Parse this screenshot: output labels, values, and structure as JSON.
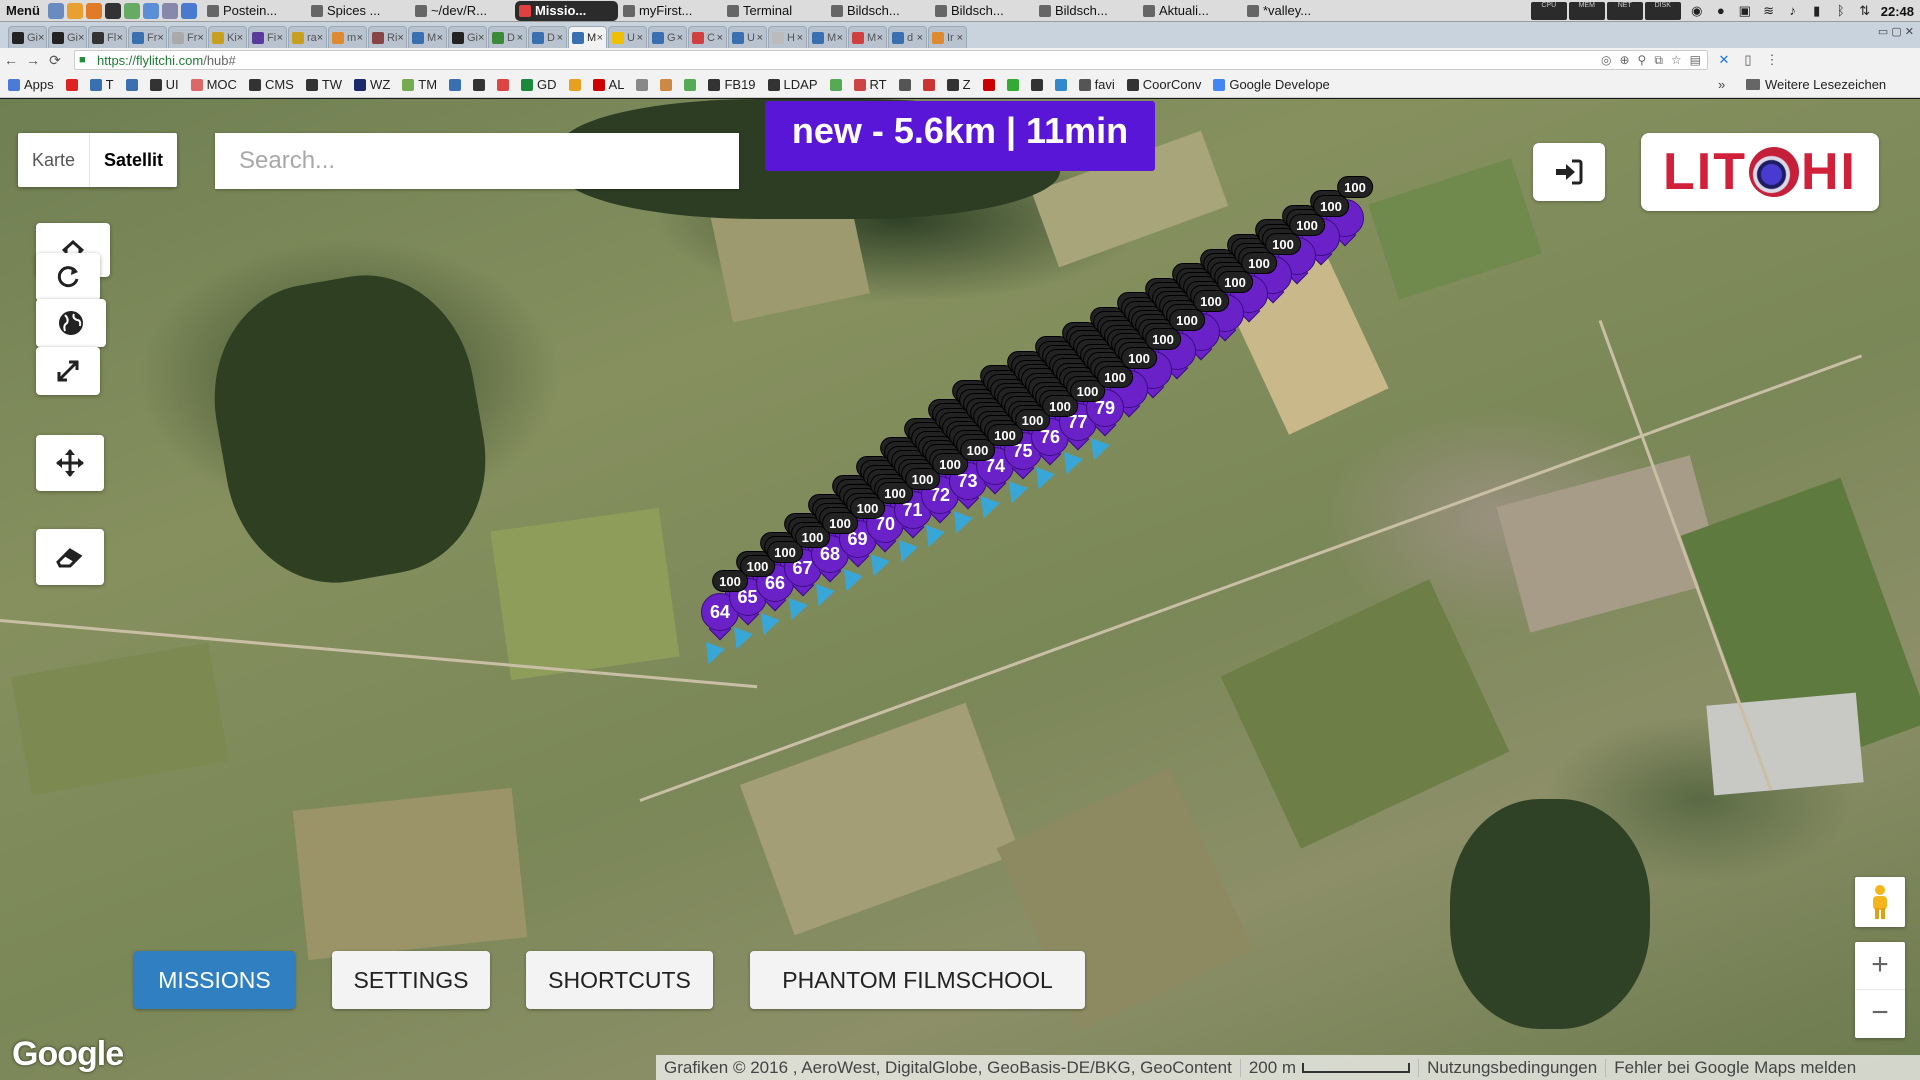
{
  "os_panel": {
    "menu_label": "Menü",
    "tasks": [
      {
        "label": "Postein...",
        "color": "#d9d9d9"
      },
      {
        "label": "Spices ...",
        "color": "#d9d9d9"
      },
      {
        "label": "~/dev/R...",
        "color": "#d9d9d9"
      },
      {
        "label": "Missio...",
        "color": "#2b2b2b",
        "active": true
      },
      {
        "label": "myFirst...",
        "color": "#d9d9d9"
      },
      {
        "label": "Terminal",
        "color": "#d9d9d9"
      },
      {
        "label": "Bildsch...",
        "color": "#d9d9d9"
      },
      {
        "label": "Bildsch...",
        "color": "#d9d9d9"
      },
      {
        "label": "Bildsch...",
        "color": "#d9d9d9"
      },
      {
        "label": "Aktuali...",
        "color": "#d9d9d9"
      },
      {
        "label": "*valley...",
        "color": "#d9d9d9"
      }
    ],
    "monitors": [
      "CPU",
      "MEM",
      "NET",
      "DISK"
    ],
    "clock": "22:48"
  },
  "browser": {
    "tabs": [
      {
        "label": "Gi",
        "color": "#222"
      },
      {
        "label": "Gi",
        "color": "#222"
      },
      {
        "label": "Fl",
        "color": "#333"
      },
      {
        "label": "Fr",
        "color": "#3a6fb0"
      },
      {
        "label": "Fr",
        "color": "#aaa"
      },
      {
        "label": "Ki",
        "color": "#c8a020"
      },
      {
        "label": "Fi",
        "color": "#5a3a9a"
      },
      {
        "label": "ra",
        "color": "#c8a020"
      },
      {
        "label": "m",
        "color": "#e08a30"
      },
      {
        "label": "Ri",
        "color": "#884444"
      },
      {
        "label": "M",
        "color": "#3a6fb0"
      },
      {
        "label": "Gi",
        "color": "#222"
      },
      {
        "label": "D",
        "color": "#3a8a3a"
      },
      {
        "label": "D",
        "color": "#3a6fb0"
      },
      {
        "label": "M",
        "color": "#3a6fb0",
        "active": true
      },
      {
        "label": "U",
        "color": "#f0c000"
      },
      {
        "label": "G",
        "color": "#3a6fb0"
      },
      {
        "label": "C",
        "color": "#d04040"
      },
      {
        "label": "U",
        "color": "#3a6fb0"
      },
      {
        "label": "H",
        "color": "#bbb"
      },
      {
        "label": "M",
        "color": "#3a6fb0"
      },
      {
        "label": "M",
        "color": "#d04040"
      },
      {
        "label": "d",
        "color": "#3a6fb0"
      },
      {
        "label": "Ir",
        "color": "#e08a30"
      }
    ],
    "url_host": "https://flylitchi.com",
    "url_path": "/hub#"
  },
  "bookmarks": [
    {
      "label": "Apps",
      "color": "#4b7bd6"
    },
    {
      "label": "",
      "color": "#d22"
    },
    {
      "label": "T",
      "color": "#3a6fb0"
    },
    {
      "label": "",
      "color": "#3a6fb0"
    },
    {
      "label": "UI",
      "color": "#333"
    },
    {
      "label": "MOC",
      "color": "#d66"
    },
    {
      "label": "CMS",
      "color": "#333"
    },
    {
      "label": "TW",
      "color": "#333"
    },
    {
      "label": "WZ",
      "color": "#1b2a6b"
    },
    {
      "label": "TM",
      "color": "#7a5"
    },
    {
      "label": "",
      "color": "#3a6fb0"
    },
    {
      "label": "",
      "color": "#333"
    },
    {
      "label": "",
      "color": "#d44"
    },
    {
      "label": "GD",
      "color": "#1a8a3a"
    },
    {
      "label": "",
      "color": "#e8a020"
    },
    {
      "label": "AL",
      "color": "#c00"
    },
    {
      "label": "",
      "color": "#888"
    },
    {
      "label": "",
      "color": "#c84"
    },
    {
      "label": "",
      "color": "#5a5"
    },
    {
      "label": "FB19",
      "color": "#333"
    },
    {
      "label": "LDAP",
      "color": "#333"
    },
    {
      "label": "",
      "color": "#5a5"
    },
    {
      "label": "RT",
      "color": "#c44"
    },
    {
      "label": "",
      "color": "#555"
    },
    {
      "label": "",
      "color": "#c33"
    },
    {
      "label": "Z",
      "color": "#333"
    },
    {
      "label": "",
      "color": "#c00"
    },
    {
      "label": "",
      "color": "#3a3"
    },
    {
      "label": "",
      "color": "#333"
    },
    {
      "label": "",
      "color": "#38c"
    },
    {
      "label": "favi",
      "color": "#555"
    },
    {
      "label": "CoorConv",
      "color": "#333"
    },
    {
      "label": "Google Develope",
      "color": "#4285f4"
    }
  ],
  "bookmarks_more": "»",
  "bookmarks_other": "Weitere Lesezeichen",
  "map": {
    "type_map_label": "Karte",
    "type_satellite_label": "Satellit",
    "search_placeholder": "Search...",
    "mission_summary": "new - 5.6km | 11min",
    "logo_left": "LIT",
    "logo_right": "HI",
    "waypoint_numbers": [
      64,
      65,
      66,
      67,
      68,
      69,
      70,
      71,
      72,
      73,
      74,
      75,
      76,
      77,
      79
    ],
    "altitude_label": "100",
    "nav": {
      "missions": "MISSIONS",
      "settings": "SETTINGS",
      "shortcuts": "SHORTCUTS",
      "filmschool": "PHANTOM FILMSCHOOL"
    },
    "zoom_in": "+",
    "zoom_out": "−",
    "google_logo": "Google",
    "attribution": "Grafiken © 2016 , AeroWest, DigitalGlobe, GeoBasis-DE/BKG, GeoContent",
    "scale": "200 m",
    "terms": "Nutzungsbedingungen",
    "report": "Fehler bei Google Maps melden"
  },
  "colors": {
    "waypoint": "#6a22c8",
    "mission_badge": "#5a16d6",
    "nav_active": "#2f7fc1",
    "logo_red": "#d0203a"
  }
}
